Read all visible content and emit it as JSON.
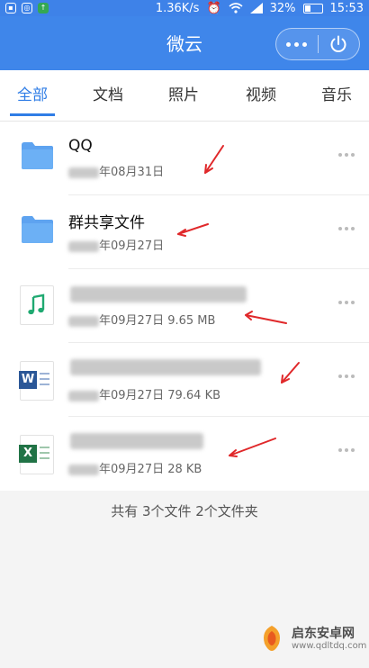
{
  "status_bar": {
    "speed": "1.36K/s",
    "battery": "32%",
    "time": "15:53"
  },
  "header": {
    "title": "微云",
    "more_icon": "more-dots-icon",
    "power_icon": "power-icon",
    "background": "#3f86ea"
  },
  "tabs": [
    {
      "label": "全部",
      "active": true
    },
    {
      "label": "文档",
      "active": false
    },
    {
      "label": "照片",
      "active": false
    },
    {
      "label": "视频",
      "active": false
    },
    {
      "label": "音乐",
      "active": false
    }
  ],
  "files": [
    {
      "name": "QQ",
      "date": "年08月31日",
      "size": "",
      "type": "folder-icon"
    },
    {
      "name": "群共享文件",
      "date": "年09月27日",
      "size": "",
      "type": "folder-icon"
    },
    {
      "name": "",
      "date": "年09月27日",
      "size": "9.65 MB",
      "type": "music-file-icon"
    },
    {
      "name": "",
      "date": "年09月27日",
      "size": "79.64 KB",
      "type": "word-file-icon"
    },
    {
      "name": "",
      "date": "年09月27日",
      "size": "28 KB",
      "type": "excel-file-icon"
    }
  ],
  "footer_text": "共有 3个文件 2个文件夹",
  "watermark": {
    "title": "启东安卓网",
    "url": "www.qdltdq.com"
  },
  "colors": {
    "accent": "#2f7de6",
    "annotation_arrow": "#e0282a",
    "word": "#2b5797",
    "excel": "#217346",
    "music": "#1fa971"
  }
}
